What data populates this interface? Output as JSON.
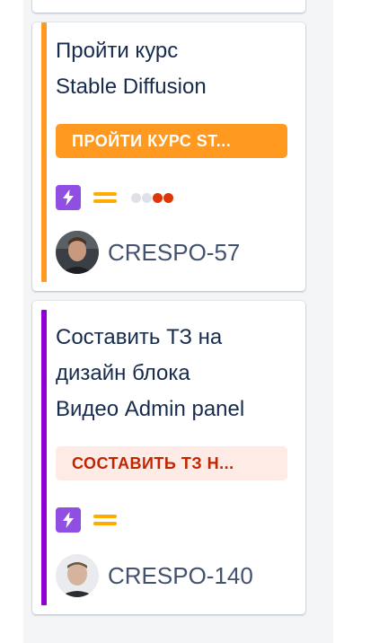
{
  "colors": {
    "column_bg": "#f4f5f7",
    "card_title": "#172b4d",
    "issue_key": "#42526e",
    "story_icon_bg": "#904ee2",
    "priority_medium": "#ffab00"
  },
  "cards": [
    {
      "title_line1": "Пройти курс",
      "title_line2": "Stable Diffusion",
      "epic_label": "ПРОЙТИ КУРС ST...",
      "stripe_color": "#ff991f",
      "epic_bg": "#ff991f",
      "epic_text_color": "#ffffff",
      "issue_type_icon": "lightning-icon",
      "priority_icon": "priority-medium-icon",
      "dots_icon": "dots-icon",
      "issue_key": "CRESPO-57"
    },
    {
      "title_line1": "Составить ТЗ на",
      "title_line2": "дизайн блока",
      "title_line3": "Видео Admin panel",
      "epic_label": "СОСТАВИТЬ ТЗ Н...",
      "stripe_color": "#8f00d6",
      "epic_bg": "#ffebe6",
      "epic_text_color": "#bf2600",
      "issue_type_icon": "lightning-icon",
      "priority_icon": "priority-medium-icon",
      "issue_key": "CRESPO-140"
    }
  ]
}
